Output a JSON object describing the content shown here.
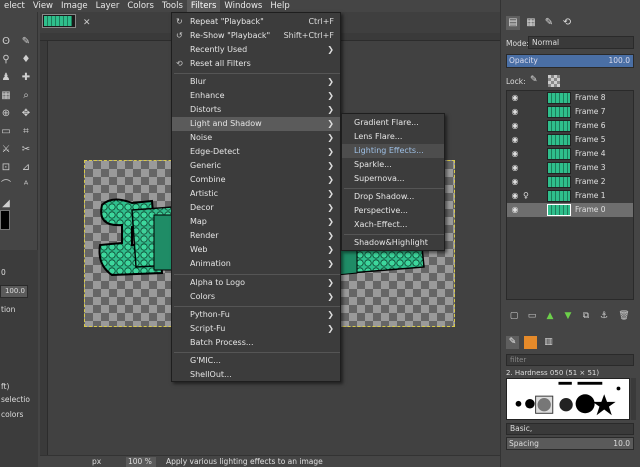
{
  "menubar": [
    "elect",
    "View",
    "Image",
    "Layer",
    "Colors",
    "Tools",
    "Filters",
    "Windows",
    "Help"
  ],
  "filters_menu": {
    "repeat": {
      "label": "Repeat \"Playback\"",
      "shortcut": "Ctrl+F"
    },
    "reshow": {
      "label": "Re-Show \"Playback\"",
      "shortcut": "Shift+Ctrl+F"
    },
    "recently_used": "Recently Used",
    "reset_all": "Reset all Filters",
    "groups": [
      [
        "Blur",
        "Enhance",
        "Distorts",
        "Light and Shadow",
        "Noise",
        "Edge-Detect",
        "Generic",
        "Combine",
        "Artistic",
        "Decor",
        "Map",
        "Render",
        "Web",
        "Animation"
      ],
      [
        "Alpha to Logo",
        "Colors"
      ],
      [
        "Python-Fu",
        "Script-Fu",
        "Batch Process..."
      ],
      [
        "G'MIC...",
        "ShellOut..."
      ]
    ]
  },
  "light_submenu": {
    "groups": [
      [
        "Gradient Flare...",
        "Lens Flare...",
        "Lighting Effects...",
        "Sparkle...",
        "Supernova..."
      ],
      [
        "Drop Shadow...",
        "Perspective...",
        "Xach-Effect..."
      ],
      [
        "Shadow&Highlight"
      ]
    ]
  },
  "tool_options": {
    "value": "100.0",
    "lines": [
      "0",
      "tion",
      "ft)",
      "selectio",
      "colors"
    ]
  },
  "status": {
    "unit": "px",
    "zoom": "100 %",
    "message": "Apply various lighting effects to an image"
  },
  "layers": {
    "mode_label": "Mode:",
    "mode_value": "Normal",
    "opacity_label": "Opacity",
    "opacity_value": "100.0",
    "lock_label": "Lock:",
    "items": [
      "Frame 8",
      "Frame 7",
      "Frame 6",
      "Frame 5",
      "Frame 4",
      "Frame 3",
      "Frame 2",
      "Frame 1",
      "Frame 0"
    ],
    "selected": "Frame 0"
  },
  "brushes": {
    "filter_placeholder": "filter",
    "current": "2. Hardness 050 (51 × 51)",
    "preset": "Basic,",
    "spacing_label": "Spacing",
    "spacing_value": "10.0"
  },
  "colors": {
    "selection": "#d8c94a",
    "art_green": "#2fbf8c",
    "highlight": "#9ec0e6"
  }
}
